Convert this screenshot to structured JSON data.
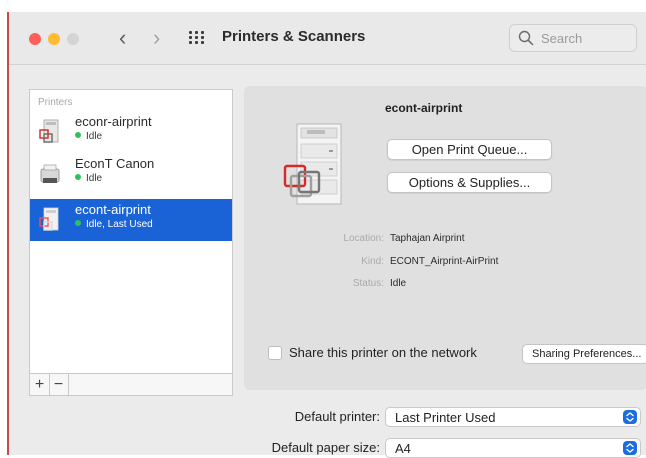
{
  "toolbar": {
    "title": "Printers & Scanners",
    "search_placeholder": "Search",
    "back_icon": "‹",
    "forward_icon": "›"
  },
  "colors": {
    "close": "#fe5f57",
    "minimize": "#febc2e",
    "zoom": "#d4d4d4",
    "selection": "#1a63d6",
    "status_idle": "#2ec25a"
  },
  "printers_list": {
    "header": "Printers",
    "items": [
      {
        "name": "econr-airprint",
        "status": "Idle",
        "selected": false
      },
      {
        "name": "EconT Canon",
        "status": "Idle",
        "selected": false
      },
      {
        "name": "econt-airprint",
        "status": "Idle, Last Used",
        "selected": true
      }
    ],
    "add_label": "+",
    "remove_label": "−"
  },
  "detail": {
    "printer_name": "econt-airprint",
    "open_queue_label": "Open Print Queue...",
    "options_label": "Options & Supplies...",
    "location_label": "Location:",
    "location_value": "Taphajan Airprint",
    "kind_label": "Kind:",
    "kind_value": "ECONT_Airprint-AirPrint",
    "status_label": "Status:",
    "status_value": "Idle",
    "share_label": "Share this printer on the network",
    "share_checked": false,
    "sharing_prefs_label": "Sharing Preferences..."
  },
  "footer": {
    "default_printer_label": "Default printer:",
    "default_printer_value": "Last Printer Used",
    "default_paper_label": "Default paper size:",
    "default_paper_value": "A4"
  }
}
